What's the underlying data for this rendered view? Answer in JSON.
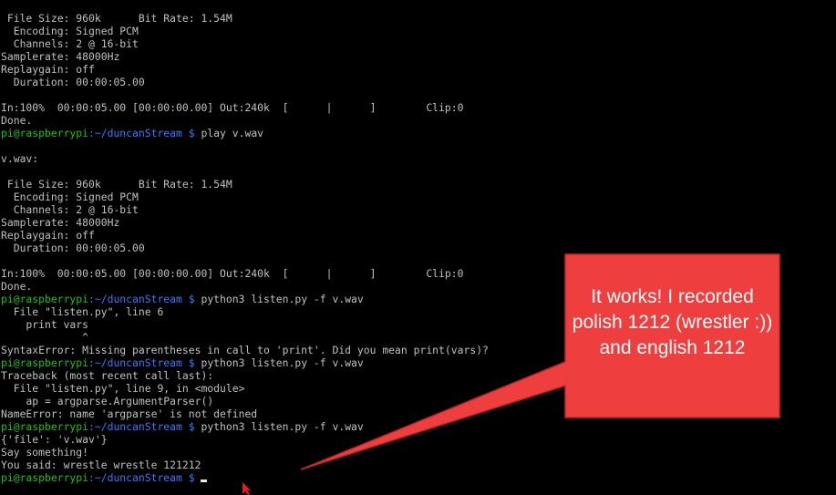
{
  "terminal": {
    "lines": [
      {
        "text": " File Size: 960k      Bit Rate: 1.54M"
      },
      {
        "text": "  Encoding: Signed PCM"
      },
      {
        "text": "  Channels: 2 @ 16-bit"
      },
      {
        "text": "Samplerate: 48000Hz"
      },
      {
        "text": "Replaygain: off"
      },
      {
        "text": "  Duration: 00:00:05.00"
      },
      {
        "text": ""
      },
      {
        "text": "In:100%  00:00:05.00 [00:00:00.00] Out:240k  [      |      ]        Clip:0"
      },
      {
        "text": "Done."
      },
      {
        "prompt_user": "pi@raspberrypi",
        "prompt_path": ":~/duncanStream $",
        "command": " play v.wav"
      },
      {
        "text": ""
      },
      {
        "text": "v.wav:"
      },
      {
        "text": ""
      },
      {
        "text": " File Size: 960k      Bit Rate: 1.54M"
      },
      {
        "text": "  Encoding: Signed PCM"
      },
      {
        "text": "  Channels: 2 @ 16-bit"
      },
      {
        "text": "Samplerate: 48000Hz"
      },
      {
        "text": "Replaygain: off"
      },
      {
        "text": "  Duration: 00:00:05.00"
      },
      {
        "text": ""
      },
      {
        "text": "In:100%  00:00:05.00 [00:00:00.00] Out:240k  [      |      ]        Clip:0"
      },
      {
        "text": "Done."
      },
      {
        "prompt_user": "pi@raspberrypi",
        "prompt_path": ":~/duncanStream $",
        "command": " python3 listen.py -f v.wav"
      },
      {
        "text": "  File \"listen.py\", line 6"
      },
      {
        "text": "    print vars"
      },
      {
        "text": "             ^"
      },
      {
        "text": "SyntaxError: Missing parentheses in call to 'print'. Did you mean print(vars)?"
      },
      {
        "prompt_user": "pi@raspberrypi",
        "prompt_path": ":~/duncanStream $",
        "command": " python3 listen.py -f v.wav"
      },
      {
        "text": "Traceback (most recent call last):"
      },
      {
        "text": "  File \"listen.py\", line 9, in <module>"
      },
      {
        "text": "    ap = argparse.ArgumentParser()"
      },
      {
        "text": "NameError: name 'argparse' is not defined"
      },
      {
        "prompt_user": "pi@raspberrypi",
        "prompt_path": ":~/duncanStream $",
        "command": " python3 listen.py -f v.wav"
      },
      {
        "text": "{'file': 'v.wav'}"
      },
      {
        "text": "Say something!"
      },
      {
        "text": "You said: wrestle wrestle 121212"
      },
      {
        "prompt_user": "pi@raspberrypi",
        "prompt_path": ":~/duncanStream $",
        "command": " ",
        "cursor": true
      }
    ]
  },
  "callout": {
    "text": "It works! I recorded polish 1212 (wrestler :)) and english 1212"
  },
  "colors": {
    "background": "#000000",
    "foreground": "#c0c0c0",
    "prompt_user": "#16c60c",
    "prompt_path": "#3b78ff",
    "callout_fill": "#ef3e3e",
    "callout_border": "#c42525",
    "mouse_cursor": "#e02020"
  },
  "icons": {
    "mouse_cursor": "arrow-pointer-icon"
  }
}
